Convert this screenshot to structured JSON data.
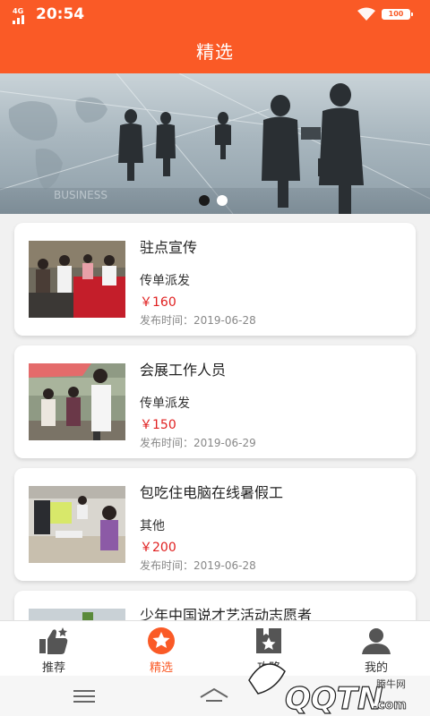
{
  "status_bar": {
    "network": "4G",
    "time": "20:54",
    "battery": "100"
  },
  "header": {
    "title": "精选"
  },
  "banner": {
    "active_slide": 1,
    "slide_count": 2
  },
  "jobs": [
    {
      "title": "驻点宣传",
      "category": "传单派发",
      "price": "￥160",
      "date": "发布时间：2019-06-28"
    },
    {
      "title": "会展工作人员",
      "category": "传单派发",
      "price": "￥150",
      "date": "发布时间：2019-06-29"
    },
    {
      "title": "包吃住电脑在线暑假工",
      "category": "其他",
      "price": "￥200",
      "date": "发布时间：2019-06-28"
    },
    {
      "title": "少年中国说才艺活动志愿者",
      "category": "",
      "price": "",
      "date": ""
    }
  ],
  "tabs": [
    {
      "label": "推荐",
      "icon": "thumbs-up-icon"
    },
    {
      "label": "精选",
      "icon": "star-circle-icon"
    },
    {
      "label": "攻略",
      "icon": "bookmark-star-icon"
    },
    {
      "label": "我的",
      "icon": "person-icon"
    }
  ],
  "active_tab": 1,
  "watermark": {
    "text": "腾牛网",
    "logo_text": "QQTN.com"
  },
  "colors": {
    "accent": "#fa5a26",
    "price": "#e02020"
  }
}
